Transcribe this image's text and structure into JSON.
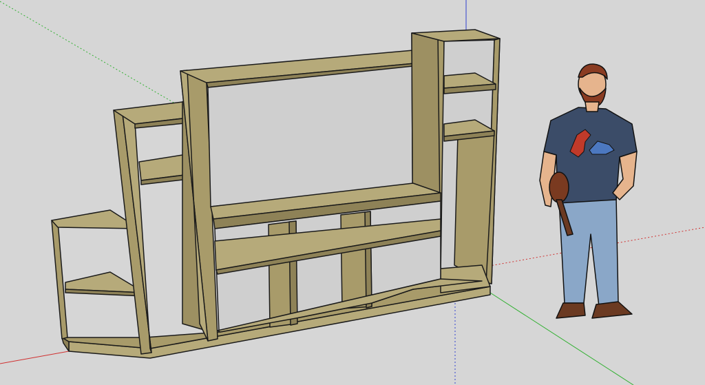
{
  "scene": {
    "type": "3d-modeling-viewport",
    "background_color": "#d6d6d6",
    "axes": {
      "red": "#d03030",
      "green": "#30b030",
      "blue": "#3040d0"
    },
    "model": {
      "name": "shelving-unit",
      "wood_color": "#a89b6a",
      "wood_light": "#b6aa7a",
      "wood_dark": "#8e8257",
      "edge_color": "#1a1a1a"
    },
    "person": {
      "name": "scale-figure",
      "shirt_color": "#3b4c68",
      "jeans_color": "#8aa7c8",
      "skin_color": "#e6b48d",
      "hair_color": "#8a3c22",
      "shoe_color": "#6b3a22"
    }
  }
}
